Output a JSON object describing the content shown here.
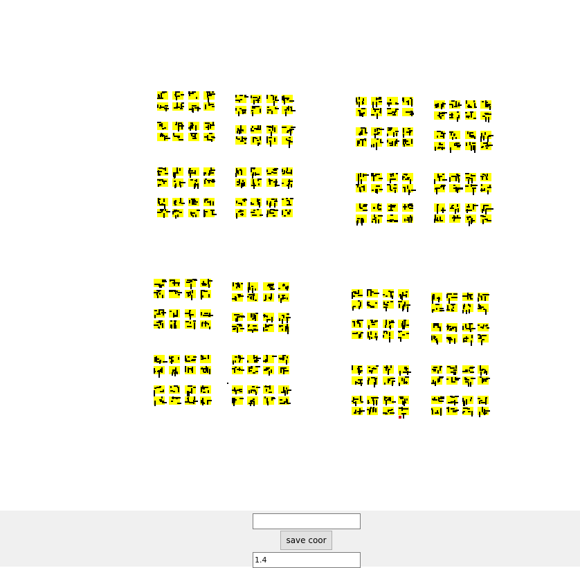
{
  "canvas": {
    "description_note": "",
    "marker_fill": "#ffff00",
    "marker_ink": "#000000",
    "highlight_color": "#cc0000"
  },
  "panel": {
    "background": "#f0f0f0",
    "coordinate_entry_value": "",
    "save_button_label": "save coor",
    "scale_entry_value": "1.4"
  }
}
